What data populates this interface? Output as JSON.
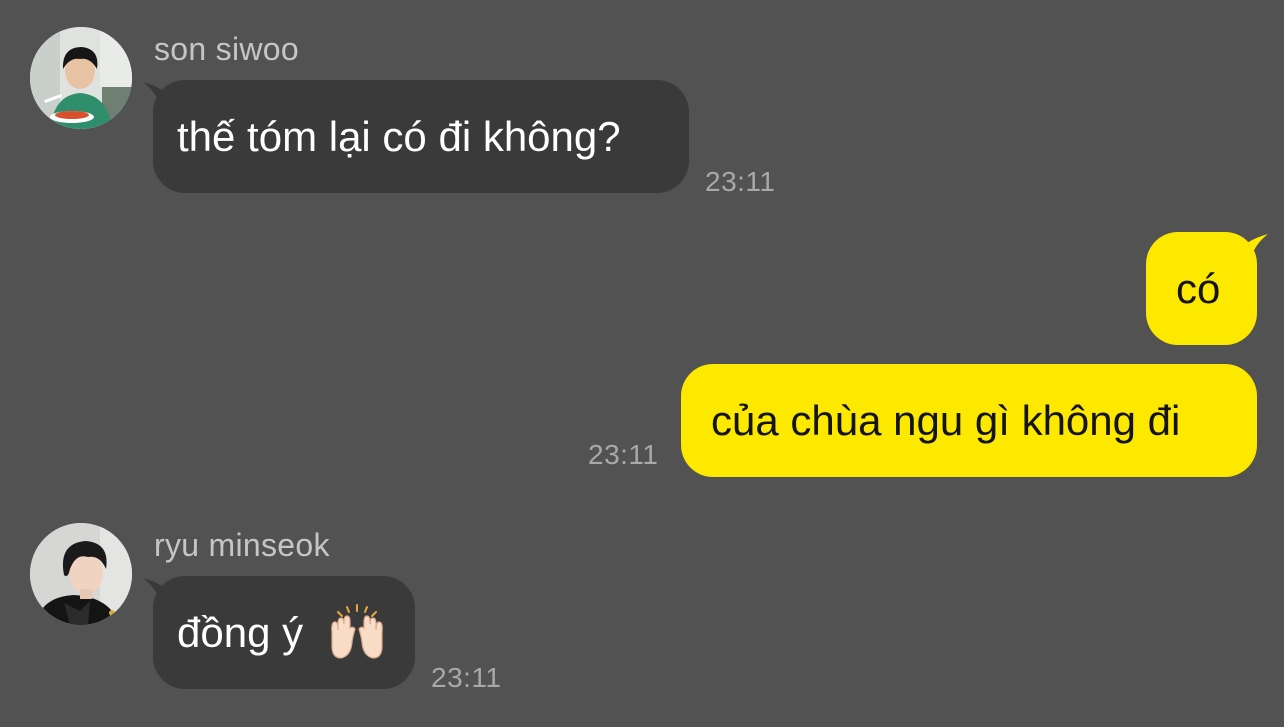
{
  "colors": {
    "background": "#535253",
    "incoming_bubble": "#3b3a3b",
    "outgoing_bubble": "#fde800",
    "sender_name": "#c6c5c6",
    "timestamp": "#a9a8a9"
  },
  "messages": [
    {
      "direction": "incoming",
      "sender": "son siwoo",
      "avatar_icon": "profile-photo-young-man-eating",
      "text": "thế tóm lại có đi không?",
      "time": "23:11"
    },
    {
      "direction": "outgoing",
      "text": "có"
    },
    {
      "direction": "outgoing",
      "text": "của chùa ngu gì không đi",
      "time": "23:11"
    },
    {
      "direction": "incoming",
      "sender": "ryu minseok",
      "avatar_icon": "profile-photo-young-man-portrait",
      "text": "đồng ý",
      "emoji": "raising-hands-emoji",
      "time": "23:11"
    }
  ]
}
